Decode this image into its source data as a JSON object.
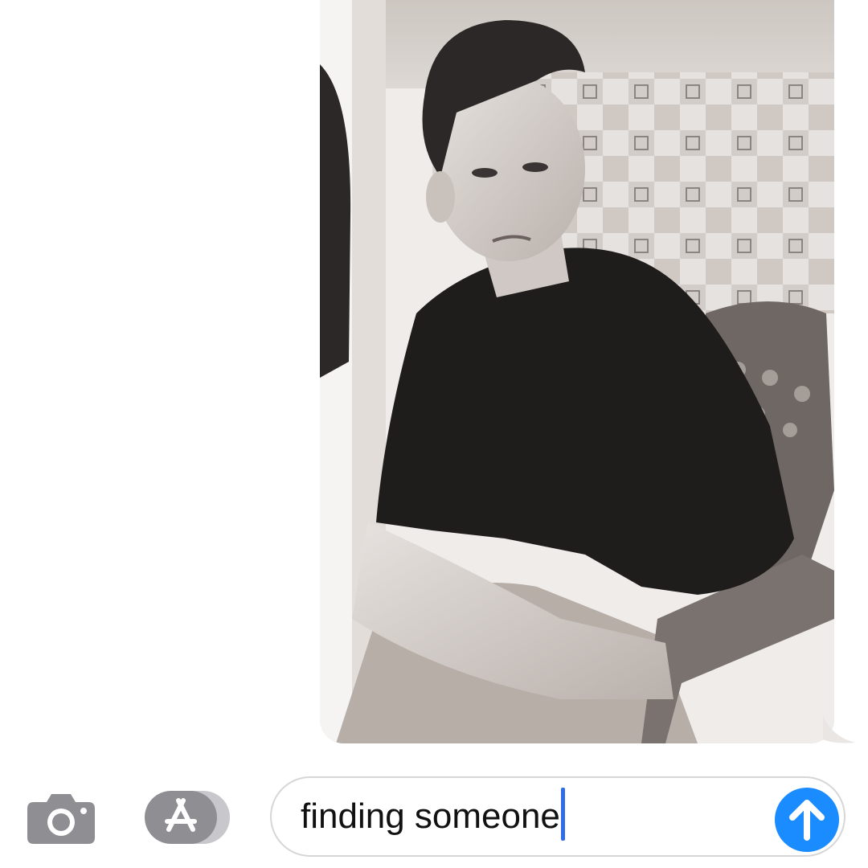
{
  "conversation": {
    "photo_message": {
      "description_icon": "photo-attachment"
    }
  },
  "input_bar": {
    "camera_icon": "camera-icon",
    "apps_icon": "app-store-icon",
    "message_text": "finding someone",
    "send_icon": "arrow-up-icon"
  },
  "colors": {
    "send_blue": "#1a8cff",
    "cursor_blue": "#2f6bea",
    "icon_gray": "#8e8e93",
    "field_border": "#d6d6d8"
  }
}
